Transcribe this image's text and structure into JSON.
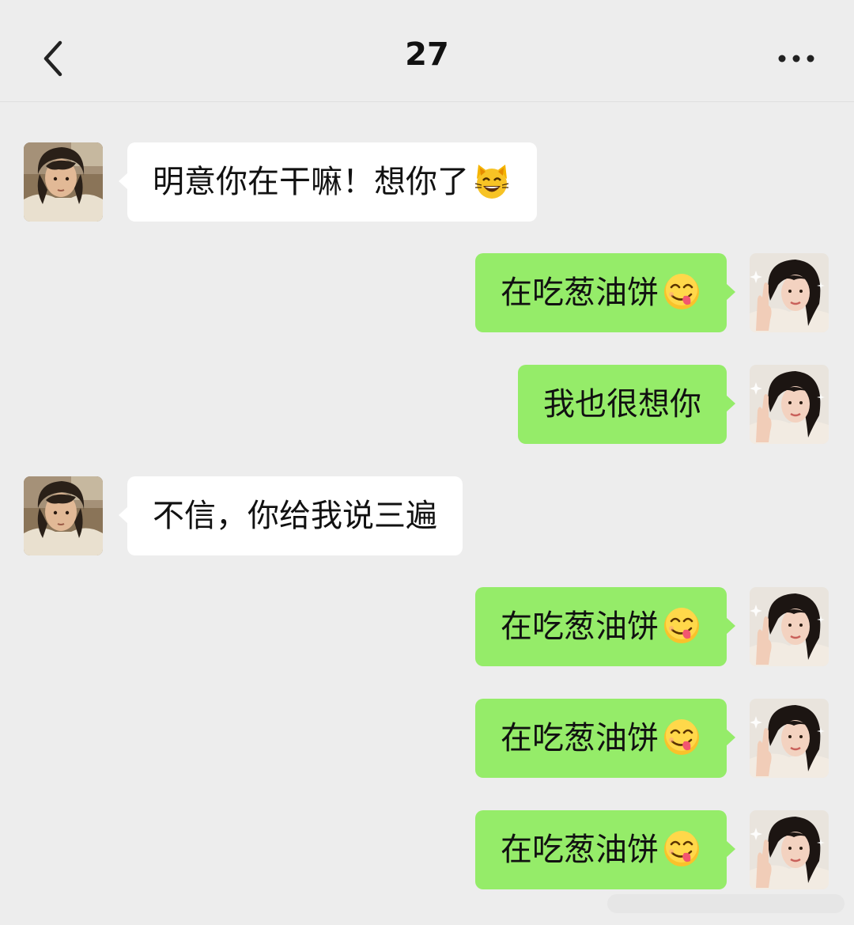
{
  "header": {
    "title": "27"
  },
  "icons": {
    "back": "chevron-left-icon",
    "more": "more-dots-icon",
    "emoji_cat": "grinning-cat-emoji",
    "emoji_yum": "face-savoring-food-emoji"
  },
  "colors": {
    "background": "#ededed",
    "incoming_bubble": "#ffffff",
    "outgoing_bubble": "#95ec69"
  },
  "messages": [
    {
      "sender": "contact",
      "text": "明意你在干嘛！想你了",
      "emoji": "grinning-cat-emoji"
    },
    {
      "sender": "me",
      "text": "在吃葱油饼",
      "emoji": "face-savoring-food-emoji"
    },
    {
      "sender": "me",
      "text": "我也很想你"
    },
    {
      "sender": "contact",
      "text": "不信，你给我说三遍"
    },
    {
      "sender": "me",
      "text": "在吃葱油饼",
      "emoji": "face-savoring-food-emoji"
    },
    {
      "sender": "me",
      "text": "在吃葱油饼",
      "emoji": "face-savoring-food-emoji"
    },
    {
      "sender": "me",
      "text": "在吃葱油饼",
      "emoji": "face-savoring-food-emoji"
    }
  ]
}
